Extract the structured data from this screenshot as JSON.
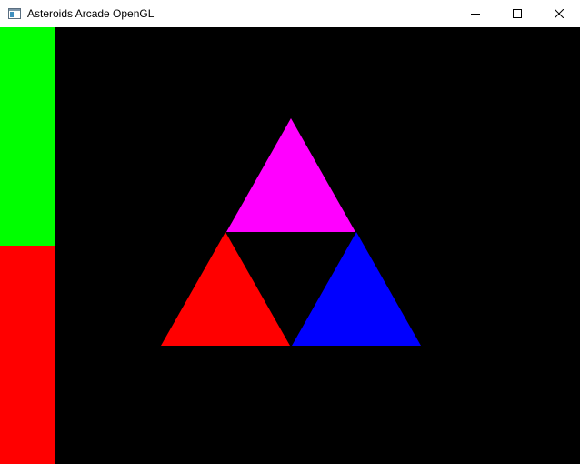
{
  "window": {
    "title": "Asteroids Arcade OpenGL",
    "icon": "app-window-icon",
    "controls": [
      "minimize-icon",
      "maximize-icon",
      "close-icon"
    ]
  },
  "viewport": {
    "background_color": "#000000",
    "side_bars": [
      {
        "name": "green-bar",
        "color": "#00ff00"
      },
      {
        "name": "red-bar",
        "color": "#ff0000"
      }
    ],
    "triangles": [
      {
        "name": "top-triangle",
        "color": "#ff00ff"
      },
      {
        "name": "bottom-left-triangle",
        "color": "#ff0000"
      },
      {
        "name": "bottom-right-triangle",
        "color": "#0000ff"
      }
    ]
  }
}
